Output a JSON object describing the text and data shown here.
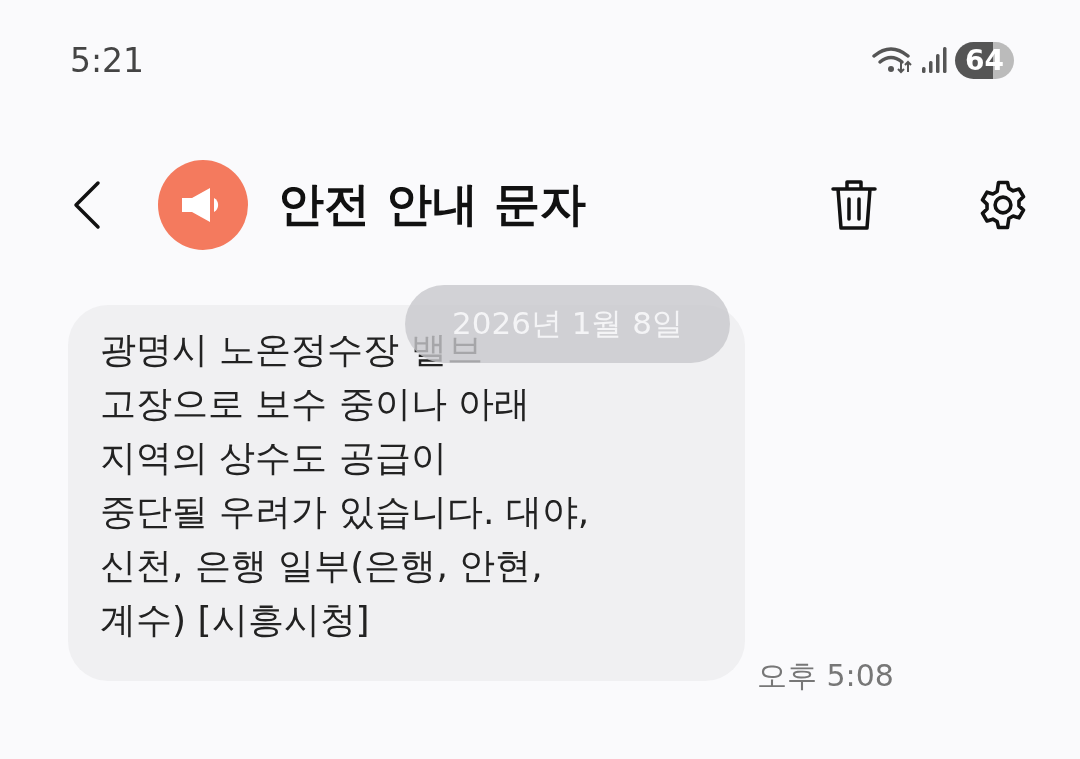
{
  "status_bar": {
    "time": "5:21",
    "battery": "64"
  },
  "header": {
    "title": "안전 안내 문자"
  },
  "date_chip": "2026년 1월 8일",
  "messages": [
    {
      "text": "광명시 노온정수장 밸브\n고장으로 보수 중이나 아래\n지역의 상수도 공급이\n중단될 우려가 있습니다. 대야,\n신천, 은행 일부(은행, 안현,\n계수) [시흥시청]",
      "time": "오후 5:08"
    }
  ]
}
